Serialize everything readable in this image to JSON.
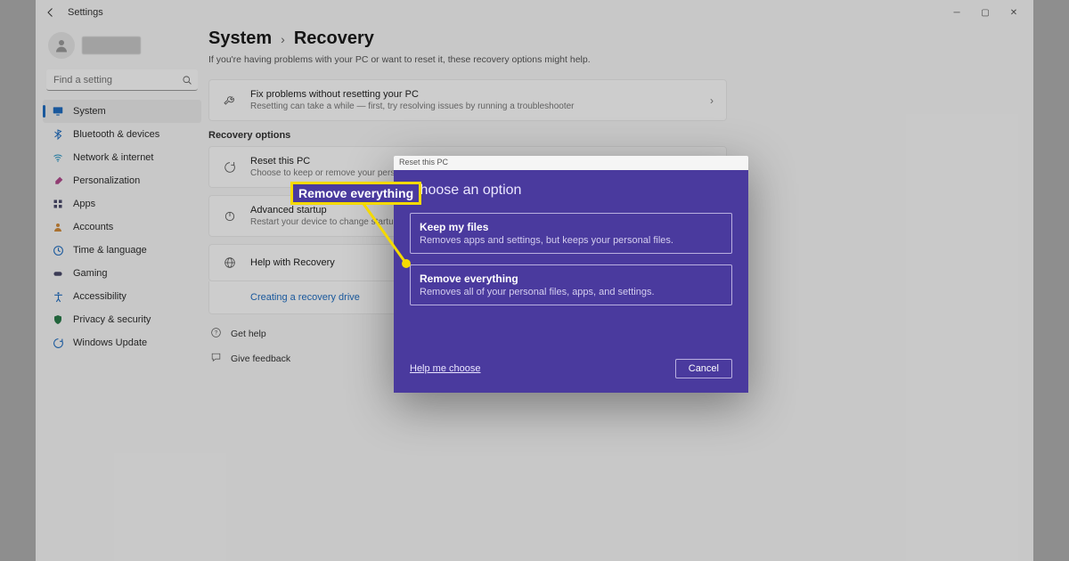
{
  "window": {
    "back_tooltip": "Back",
    "title": "Settings"
  },
  "sidebar": {
    "search_placeholder": "Find a setting",
    "items": [
      {
        "label": "System",
        "icon": "monitor-icon",
        "color": "#1f6cbf",
        "selected": true
      },
      {
        "label": "Bluetooth & devices",
        "icon": "bluetooth-icon",
        "color": "#1f6cbf"
      },
      {
        "label": "Network & internet",
        "icon": "wifi-icon",
        "color": "#1f8fbf"
      },
      {
        "label": "Personalization",
        "icon": "brush-icon",
        "color": "#b04a8c"
      },
      {
        "label": "Apps",
        "icon": "grid-icon",
        "color": "#4a4a6a"
      },
      {
        "label": "Accounts",
        "icon": "person-icon",
        "color": "#d08a3a"
      },
      {
        "label": "Time & language",
        "icon": "clock-globe-icon",
        "color": "#1f6cbf"
      },
      {
        "label": "Gaming",
        "icon": "gamepad-icon",
        "color": "#4a4a6a"
      },
      {
        "label": "Accessibility",
        "icon": "accessibility-icon",
        "color": "#1f6cbf"
      },
      {
        "label": "Privacy & security",
        "icon": "shield-icon",
        "color": "#2a7a4a"
      },
      {
        "label": "Windows Update",
        "icon": "update-icon",
        "color": "#1f6cbf"
      }
    ]
  },
  "main": {
    "crumb_parent": "System",
    "crumb_current": "Recovery",
    "subtitle": "If you're having problems with your PC or want to reset it, these recovery options might help.",
    "card_fix": {
      "title": "Fix problems without resetting your PC",
      "sub": "Resetting can take a while — first, try resolving issues by running a troubleshooter"
    },
    "section_header": "Recovery options",
    "card_reset": {
      "title": "Reset this PC",
      "sub": "Choose to keep or remove your personal files, then reinstall Windows"
    },
    "card_advanced": {
      "title": "Advanced startup",
      "sub": "Restart your device to change startup settings, including starting from a disc or USB drive"
    },
    "card_help_recovery": "Help with Recovery",
    "card_create_drive": "Creating a recovery drive",
    "footer_help": "Get help",
    "footer_feedback": "Give feedback"
  },
  "dialog": {
    "titlebar": "Reset this PC",
    "heading": "Choose an option",
    "keep_title": "Keep my files",
    "keep_sub": "Removes apps and settings, but keeps your personal files.",
    "remove_title": "Remove everything",
    "remove_sub": "Removes all of your personal files, apps, and settings.",
    "help_link": "Help me choose",
    "cancel": "Cancel"
  },
  "callout": {
    "label": "Remove everything"
  }
}
